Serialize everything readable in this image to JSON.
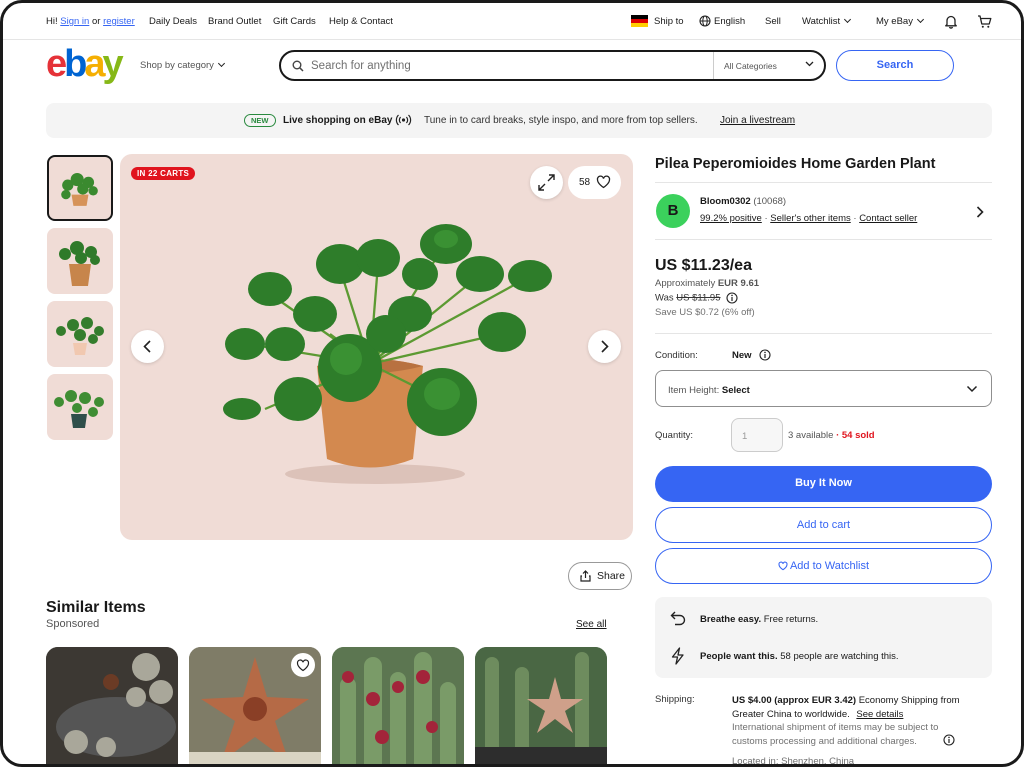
{
  "topbar": {
    "greeting": "Hi!",
    "sign_in": "Sign in",
    "or": "or",
    "register": "register",
    "daily_deals": "Daily Deals",
    "brand_outlet": "Brand Outlet",
    "gift_cards": "Gift Cards",
    "help_contact": "Help & Contact",
    "ship_to": "Ship to",
    "language": "English",
    "sell": "Sell",
    "watchlist": "Watchlist",
    "my_ebay": "My eBay"
  },
  "header": {
    "logo": [
      "e",
      "b",
      "a",
      "y"
    ],
    "shop_by_category": "Shop by category",
    "search_placeholder": "Search for anything",
    "category_select": "All Categories",
    "search_button": "Search"
  },
  "banner": {
    "badge": "NEW",
    "title": "Live shopping on eBay",
    "text": "Tune in to card breaks, style inspo, and more from top sellers.",
    "link": "Join a livestream"
  },
  "gallery": {
    "cart_badge": "IN 22 CARTS",
    "watch_count": "58",
    "share_label": "Share"
  },
  "similar": {
    "title": "Similar Items",
    "sponsored": "Sponsored",
    "see_all": "See all"
  },
  "product": {
    "title": "Pilea Peperomioides Home Garden Plant",
    "seller_initial": "B",
    "seller_name": "Bloom0302",
    "seller_score": "(10068)",
    "positive": "99.2% positive",
    "dot1": "·",
    "other_items": "Seller's other items",
    "dot2": "·",
    "contact_seller": "Contact seller",
    "price": "US $11.23/ea",
    "approx_label": "Approximately",
    "approx_value": "EUR 9.61",
    "was_label": "Was",
    "was_price": "US $11.95",
    "save": "Save US $0.72 (6% off)",
    "condition_label": "Condition:",
    "condition_value": "New",
    "variation_label": "Item Height:",
    "variation_value": "Select",
    "quantity_label": "Quantity:",
    "quantity_value": "1",
    "available": "3 available",
    "sold": "· 54 sold",
    "buy_now": "Buy It Now",
    "add_to_cart": "Add to cart",
    "add_to_watchlist": "Add to Watchlist",
    "returns_bold": "Breathe easy.",
    "returns_text": "Free returns.",
    "watch_bold": "People want this.",
    "watch_text": "58 people are watching this.",
    "shipping_label": "Shipping:",
    "shipping_cost": "US $4.00 (approx EUR 3.42)",
    "shipping_method": "Economy Shipping from Greater China to worldwide.",
    "see_details": "See details",
    "intl_note": "International shipment of items may be subject to customs processing and additional charges.",
    "located": "Located in: Shenzhen, China"
  },
  "colors": {
    "accent": "#3665f3",
    "sold_red": "#e0141e",
    "badge_red": "#e0141e",
    "avatar_green": "#3bd15c",
    "image_bg": "#f0dcd6"
  },
  "icons": [
    "search-icon",
    "chevron-down-icon",
    "bell-icon",
    "cart-icon",
    "globe-icon",
    "flag-germany-icon",
    "live-broadcast-icon",
    "expand-icon",
    "heart-icon",
    "chevron-left-icon",
    "chevron-right-icon",
    "share-icon",
    "info-icon",
    "return-arrow-icon",
    "lightning-icon"
  ]
}
